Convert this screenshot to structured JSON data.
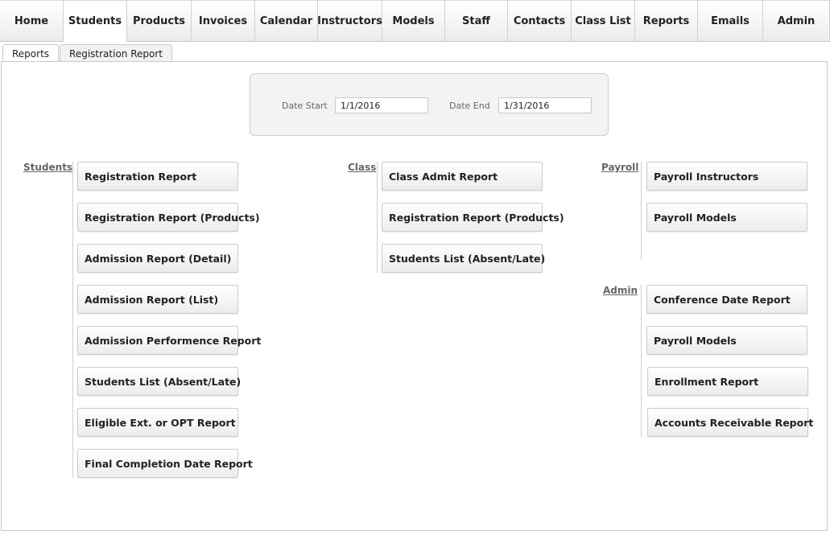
{
  "nav": {
    "items": [
      {
        "label": "Home"
      },
      {
        "label": "Students"
      },
      {
        "label": "Products"
      },
      {
        "label": "Invoices"
      },
      {
        "label": "Calendar"
      },
      {
        "label": "Instructors"
      },
      {
        "label": "Models"
      },
      {
        "label": "Staff"
      },
      {
        "label": "Contacts"
      },
      {
        "label": "Class List"
      },
      {
        "label": "Reports"
      },
      {
        "label": "Emails"
      },
      {
        "label": "Admin"
      }
    ]
  },
  "subtabs": {
    "items": [
      {
        "label": "Reports"
      },
      {
        "label": "Registration Report"
      }
    ]
  },
  "date_filter": {
    "start_label": "Date Start",
    "start_value": "1/1/2016",
    "end_label": "Date End",
    "end_value": "1/31/2016"
  },
  "sections": {
    "students": {
      "title": "Students",
      "buttons": [
        "Registration Report",
        "Registration Report (Products)",
        "Admission Report (Detail)",
        "Admission Report (List)",
        "Admission Performence Report",
        "Students List (Absent/Late)",
        "Eligible Ext. or OPT Report",
        "Final Completion Date Report"
      ]
    },
    "class": {
      "title": "Class",
      "buttons": [
        "Class Admit Report",
        "Registration Report (Products)",
        "Students List (Absent/Late)"
      ]
    },
    "payroll": {
      "title": "Payroll",
      "buttons": [
        "Payroll Instructors",
        "Payroll Models"
      ]
    },
    "admin": {
      "title": "Admin",
      "buttons": [
        "Conference Date Report",
        "Payroll Models",
        "Enrollment Report",
        "Accounts Receivable Report"
      ]
    }
  }
}
